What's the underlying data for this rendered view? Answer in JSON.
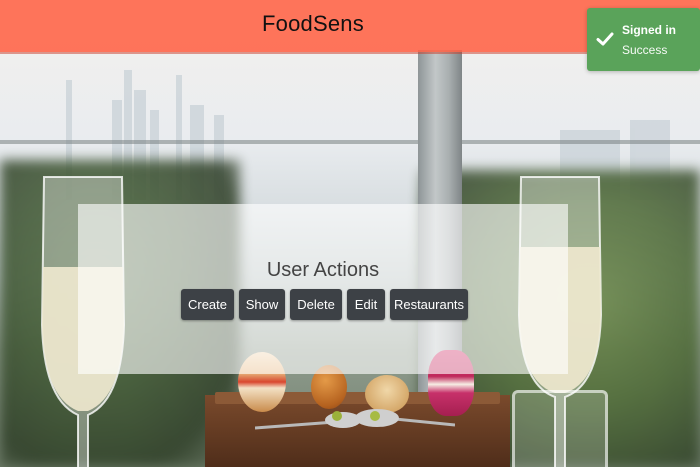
{
  "navbar": {
    "brand": "FoodSens"
  },
  "toast": {
    "title": "Signed in",
    "message": "Success",
    "icon": "checkmark-icon",
    "color": "#5aa35a"
  },
  "panel": {
    "title": "User Actions",
    "buttons": {
      "create": "Create",
      "show": "Show",
      "delete": "Delete",
      "edit": "Edit",
      "restaurants": "Restaurants"
    }
  },
  "theme": {
    "navbar_color": "#ff6246",
    "button_color": "#3d4146"
  }
}
